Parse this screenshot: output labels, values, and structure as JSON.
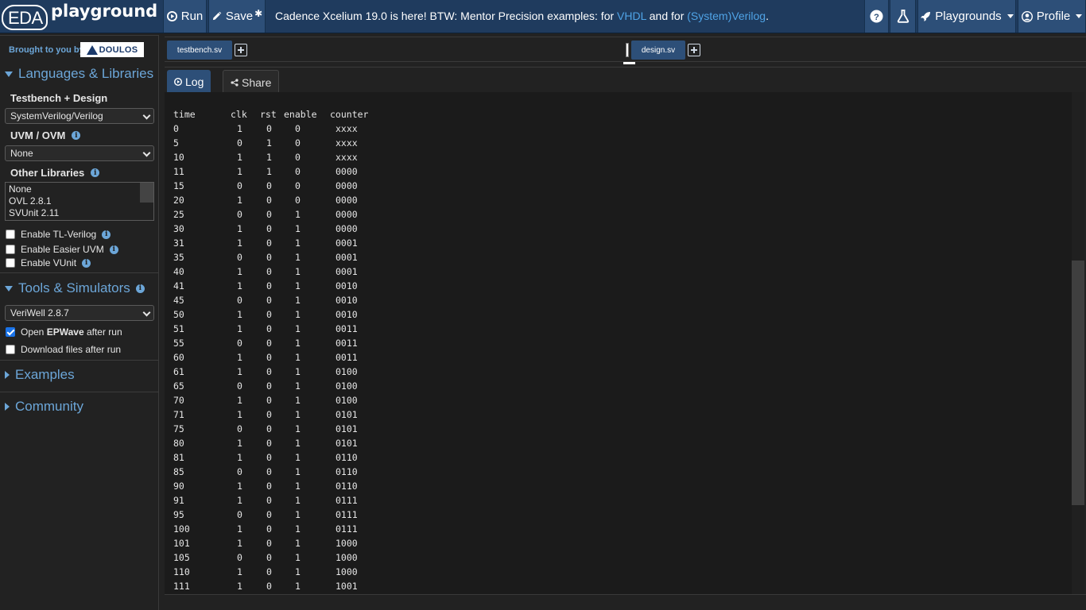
{
  "app": {
    "logo_main": "EDA",
    "logo_sub": "playground"
  },
  "toolbar": {
    "run_label": "Run",
    "save_label": "Save",
    "save_mark": "✱",
    "announcement": {
      "prefix": "Cadence Xcelium 19.0 is here! BTW: Mentor Precision examples: for ",
      "link1": "VHDL",
      "middle": " and for ",
      "link2": "(System)Verilog",
      "suffix": "."
    },
    "help_icon": "?",
    "playgrounds_label": "Playgrounds",
    "profile_label": "Profile"
  },
  "sidebar": {
    "brought_by": "Brought to you by",
    "sponsor": "DOULOS",
    "languages_header": "Languages & Libraries",
    "testbench_label": "Testbench + Design",
    "testbench_value": "SystemVerilog/Verilog",
    "uvm_label": "UVM / OVM",
    "uvm_value": "None",
    "other_libs_label": "Other Libraries",
    "other_libs": [
      "None",
      "OVL 2.8.1",
      "SVUnit 2.11"
    ],
    "checkboxes": [
      {
        "label": "Enable TL-Verilog",
        "checked": false
      },
      {
        "label": "Enable Easier UVM",
        "checked": false
      },
      {
        "label": "Enable VUnit",
        "checked": false
      }
    ],
    "tools_header": "Tools & Simulators",
    "simulator_value": "VeriWell 2.8.7",
    "epwave_pre": "Open ",
    "epwave_bold": "EPWave",
    "epwave_post": " after run",
    "epwave_checked": true,
    "download_label": "Download files after run",
    "download_checked": false,
    "examples_header": "Examples",
    "community_header": "Community"
  },
  "editor": {
    "left_tab": "testbench.sv",
    "right_tab": "design.sv"
  },
  "log_tabs": {
    "log_label": "Log",
    "share_label": "Share"
  },
  "log": {
    "headers": [
      "time",
      "clk",
      "rst",
      "enable",
      "counter"
    ],
    "rows": [
      [
        "0",
        "1",
        "0",
        "0",
        "xxxx"
      ],
      [
        "5",
        "0",
        "1",
        "0",
        "xxxx"
      ],
      [
        "10",
        "1",
        "1",
        "0",
        "xxxx"
      ],
      [
        "11",
        "1",
        "1",
        "0",
        "0000"
      ],
      [
        "15",
        "0",
        "0",
        "0",
        "0000"
      ],
      [
        "20",
        "1",
        "0",
        "0",
        "0000"
      ],
      [
        "25",
        "0",
        "0",
        "1",
        "0000"
      ],
      [
        "30",
        "1",
        "0",
        "1",
        "0000"
      ],
      [
        "31",
        "1",
        "0",
        "1",
        "0001"
      ],
      [
        "35",
        "0",
        "0",
        "1",
        "0001"
      ],
      [
        "40",
        "1",
        "0",
        "1",
        "0001"
      ],
      [
        "41",
        "1",
        "0",
        "1",
        "0010"
      ],
      [
        "45",
        "0",
        "0",
        "1",
        "0010"
      ],
      [
        "50",
        "1",
        "0",
        "1",
        "0010"
      ],
      [
        "51",
        "1",
        "0",
        "1",
        "0011"
      ],
      [
        "55",
        "0",
        "0",
        "1",
        "0011"
      ],
      [
        "60",
        "1",
        "0",
        "1",
        "0011"
      ],
      [
        "61",
        "1",
        "0",
        "1",
        "0100"
      ],
      [
        "65",
        "0",
        "0",
        "1",
        "0100"
      ],
      [
        "70",
        "1",
        "0",
        "1",
        "0100"
      ],
      [
        "71",
        "1",
        "0",
        "1",
        "0101"
      ],
      [
        "75",
        "0",
        "0",
        "1",
        "0101"
      ],
      [
        "80",
        "1",
        "0",
        "1",
        "0101"
      ],
      [
        "81",
        "1",
        "0",
        "1",
        "0110"
      ],
      [
        "85",
        "0",
        "0",
        "1",
        "0110"
      ],
      [
        "90",
        "1",
        "0",
        "1",
        "0110"
      ],
      [
        "91",
        "1",
        "0",
        "1",
        "0111"
      ],
      [
        "95",
        "0",
        "0",
        "1",
        "0111"
      ],
      [
        "100",
        "1",
        "0",
        "1",
        "0111"
      ],
      [
        "101",
        "1",
        "0",
        "1",
        "1000"
      ],
      [
        "105",
        "0",
        "0",
        "1",
        "1000"
      ],
      [
        "110",
        "1",
        "0",
        "1",
        "1000"
      ],
      [
        "111",
        "1",
        "0",
        "1",
        "1001"
      ]
    ]
  },
  "colors": {
    "header_bg": "#1f3b5e",
    "button_bg": "#2d4f78",
    "accent_link": "#4fa3e6",
    "sidebar_heading": "#6ca6d8",
    "panel_bg": "#1b1b1b"
  }
}
